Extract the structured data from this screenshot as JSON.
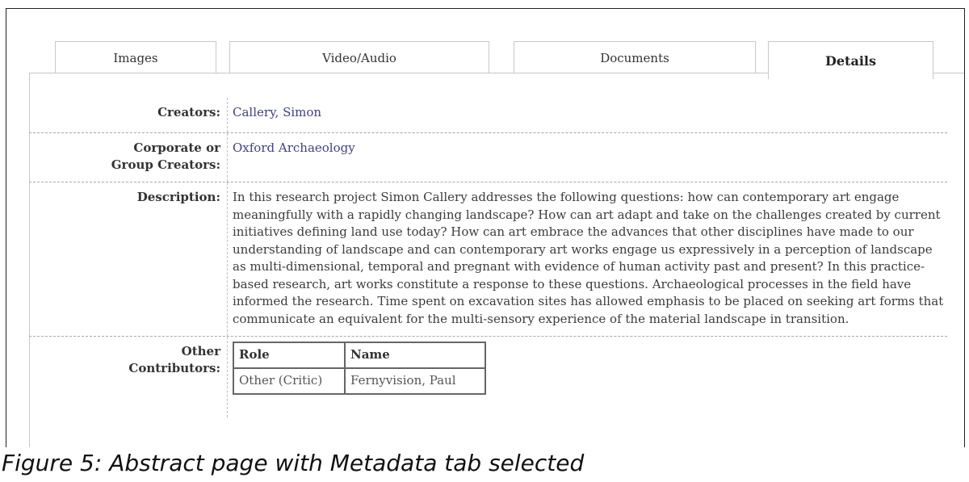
{
  "tabs": [
    {
      "label": "Images",
      "active": false
    },
    {
      "label": "Video/Audio",
      "active": false
    },
    {
      "label": "Documents",
      "active": false
    },
    {
      "label": "Details",
      "active": true
    }
  ],
  "details": {
    "creators_label": "Creators:",
    "creators_value": "Callery, Simon",
    "corporate_label_line1": "Corporate or",
    "corporate_label_line2": "Group Creators:",
    "corporate_value": "Oxford Archaeology",
    "description_label": "Description:",
    "description_value": "In this research project Simon Callery addresses the following questions: how can contemporary art engage meaningfully with a rapidly changing landscape? How can art adapt and take on the challenges created by current initiatives defining land use today? How can art embrace the advances that other disciplines have made to our understanding of landscape and can contemporary art works engage us expressively in a perception of landscape as multi-dimensional, temporal and pregnant with evidence of human activity past and present? In this practice-based research, art works constitute a response to these questions. Archaeological processes in the field have informed the research. Time spent on excavation sites has allowed emphasis to be placed on seeking art forms that communicate an equivalent for the multi-sensory experience of the material landscape in transition.",
    "other_label_line1": "Other",
    "other_label_line2": "Contributors:",
    "contributors_table": {
      "headers": [
        "Role",
        "Name"
      ],
      "rows": [
        [
          "Other (Critic)",
          "Fernyvision, Paul"
        ]
      ]
    }
  },
  "caption": "Figure 5: Abstract page with Metadata tab selected",
  "colors": {
    "link": "#3d3f88",
    "border": "#c8c8c8",
    "dash": "#a8a8a8"
  }
}
